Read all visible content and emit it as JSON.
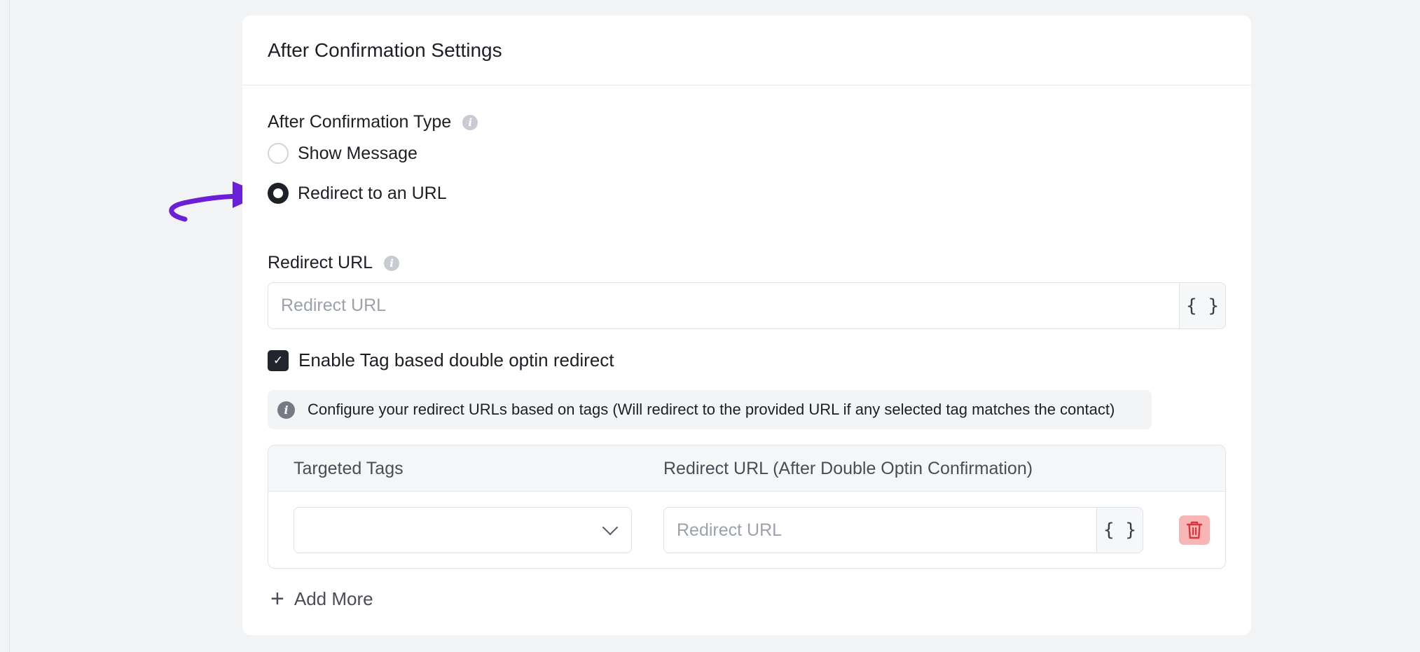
{
  "card": {
    "title": "After Confirmation Settings"
  },
  "confirmation_type": {
    "label": "After Confirmation Type",
    "options": [
      {
        "label": "Show Message",
        "checked": false
      },
      {
        "label": "Redirect to an URL",
        "checked": true
      }
    ]
  },
  "redirect_url": {
    "label": "Redirect URL",
    "placeholder": "Redirect URL",
    "value": "",
    "smartcode_label": "{ }"
  },
  "tag_redirect": {
    "checkbox_label": "Enable Tag based double optin redirect",
    "checked": true,
    "notice": "Configure your redirect URLs based on tags (Will redirect to the provided URL if any selected tag matches the contact)",
    "table": {
      "columns": [
        "Targeted Tags",
        "Redirect URL (After Double Optin Confirmation)"
      ],
      "rows": [
        {
          "tags": "",
          "url_placeholder": "Redirect URL",
          "url_value": "",
          "smartcode_label": "{ }"
        }
      ]
    },
    "add_more_label": "Add More"
  },
  "annotation": {
    "arrow_color": "#6b1fd6"
  },
  "colors": {
    "danger_bg": "#f7b5b5",
    "danger_icon": "#d9363e",
    "checkbox": "#23252e"
  }
}
